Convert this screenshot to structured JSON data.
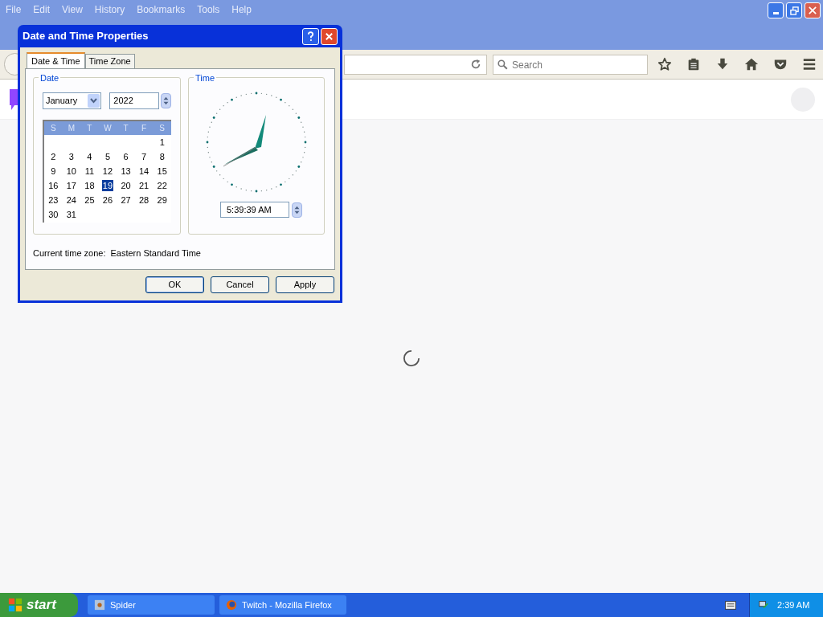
{
  "browser": {
    "menu": [
      "File",
      "Edit",
      "View",
      "History",
      "Bookmarks",
      "Tools",
      "Help"
    ],
    "search": {
      "placeholder": "Search"
    }
  },
  "dialog": {
    "title": "Date and Time Properties",
    "tabs": [
      {
        "label": "Date & Time",
        "selected": true
      },
      {
        "label": "Time Zone",
        "selected": false
      }
    ],
    "date_group": {
      "label": "Date",
      "month": "January",
      "year": "2022",
      "weekdays": [
        "S",
        "M",
        "T",
        "W",
        "T",
        "F",
        "S"
      ],
      "weeks": [
        [
          {
            "day": "1",
            "selected": false
          }
        ],
        [
          {
            "day": "2",
            "selected": false
          },
          {
            "day": "3",
            "selected": false
          },
          {
            "day": "4",
            "selected": false
          },
          {
            "day": "5",
            "selected": false
          },
          {
            "day": "6",
            "selected": false
          },
          {
            "day": "7",
            "selected": false
          },
          {
            "day": "8",
            "selected": false
          }
        ],
        [
          {
            "day": "9",
            "selected": false
          },
          {
            "day": "10",
            "selected": false
          },
          {
            "day": "11",
            "selected": false
          },
          {
            "day": "12",
            "selected": false
          },
          {
            "day": "13",
            "selected": false
          },
          {
            "day": "14",
            "selected": false
          },
          {
            "day": "15",
            "selected": false
          }
        ],
        [
          {
            "day": "16",
            "selected": false
          },
          {
            "day": "17",
            "selected": false
          },
          {
            "day": "18",
            "selected": false
          },
          {
            "day": "19",
            "selected": true
          },
          {
            "day": "20",
            "selected": false
          },
          {
            "day": "21",
            "selected": false
          },
          {
            "day": "22",
            "selected": false
          }
        ],
        [
          {
            "day": "23",
            "selected": false
          },
          {
            "day": "24",
            "selected": false
          },
          {
            "day": "25",
            "selected": false
          },
          {
            "day": "26",
            "selected": false
          },
          {
            "day": "27",
            "selected": false
          },
          {
            "day": "28",
            "selected": false
          },
          {
            "day": "29",
            "selected": false
          }
        ],
        [
          {
            "day": "30",
            "selected": false
          },
          {
            "day": "31",
            "selected": false
          }
        ]
      ]
    },
    "time_group": {
      "label": "Time",
      "time": "5:39:39 AM"
    },
    "time_zone_label": "Current time zone:",
    "time_zone": "Eastern Standard Time",
    "buttons": [
      {
        "label": "OK",
        "default": true
      },
      {
        "label": "Cancel",
        "default": false
      },
      {
        "label": "Apply",
        "default": false
      }
    ]
  },
  "taskbar": {
    "start": "start",
    "tasks": [
      {
        "label": "Spider",
        "kind": "spider"
      },
      {
        "label": "Twitch - Mozilla Firefox",
        "kind": "firefox"
      }
    ],
    "clock": "2:39 AM"
  }
}
